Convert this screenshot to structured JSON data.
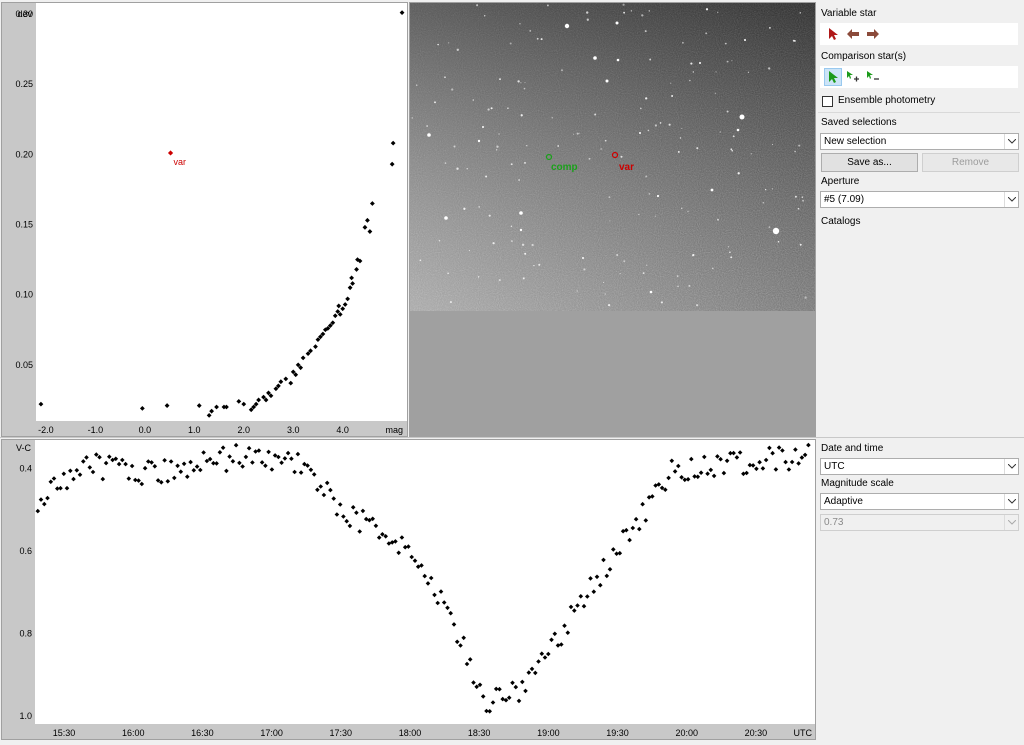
{
  "sidebar": {
    "variable_star_label": "Variable star",
    "comparison_label": "Comparison star(s)",
    "ensemble_label": "Ensemble photometry",
    "ensemble_checked": false,
    "saved_selections_label": "Saved selections",
    "saved_selection_value": "New selection",
    "save_as_label": "Save as...",
    "remove_label": "Remove",
    "aperture_label": "Aperture",
    "aperture_value": "#5 (7.09)",
    "catalogs_label": "Catalogs"
  },
  "lower_sidebar": {
    "date_time_label": "Date and time",
    "date_time_value": "UTC",
    "mag_scale_label": "Magnitude scale",
    "mag_scale_value": "Adaptive",
    "mag_scale_number": "0.73"
  },
  "image_view": {
    "comp_label": "comp",
    "var_label": "var"
  },
  "colors": {
    "var_marker": "#cc0000",
    "comp_marker": "#1aa01a",
    "axis_band": "#c8c8c8",
    "points": "#000000"
  },
  "chart_data": [
    {
      "type": "scatter",
      "xlabel": "mag",
      "ylabel": "dev",
      "xlim": [
        -2.2,
        5.3
      ],
      "ylim": [
        0.01,
        0.305
      ],
      "x_ticks": [
        -2.0,
        -1.0,
        0.0,
        1.0,
        2.0,
        3.0,
        4.0
      ],
      "x_tick_labels": [
        "-2.0",
        "-1.0",
        "0.0",
        "1.0",
        "2.0",
        "3.0",
        "4.0"
      ],
      "y_ticks": [
        0.05,
        0.1,
        0.15,
        0.2,
        0.25,
        0.3
      ],
      "y_tick_labels": [
        "0.05",
        "0.10",
        "0.15",
        "0.20",
        "0.25",
        "0.30"
      ],
      "highlight": {
        "name": "var",
        "x": 0.52,
        "y": 0.201
      },
      "points": [
        [
          -2.1,
          0.022
        ],
        [
          -0.05,
          0.019
        ],
        [
          0.45,
          0.021
        ],
        [
          1.1,
          0.021
        ],
        [
          1.3,
          0.014
        ],
        [
          1.35,
          0.017
        ],
        [
          1.45,
          0.02
        ],
        [
          1.6,
          0.02
        ],
        [
          1.65,
          0.02
        ],
        [
          1.9,
          0.024
        ],
        [
          2.0,
          0.022
        ],
        [
          2.15,
          0.018
        ],
        [
          2.2,
          0.02
        ],
        [
          2.25,
          0.022
        ],
        [
          2.3,
          0.025
        ],
        [
          2.4,
          0.027
        ],
        [
          2.45,
          0.025
        ],
        [
          2.5,
          0.03
        ],
        [
          2.55,
          0.028
        ],
        [
          2.65,
          0.033
        ],
        [
          2.7,
          0.035
        ],
        [
          2.75,
          0.038
        ],
        [
          2.85,
          0.04
        ],
        [
          2.95,
          0.037
        ],
        [
          3.0,
          0.045
        ],
        [
          3.05,
          0.043
        ],
        [
          3.1,
          0.05
        ],
        [
          3.15,
          0.048
        ],
        [
          3.2,
          0.055
        ],
        [
          3.3,
          0.058
        ],
        [
          3.35,
          0.06
        ],
        [
          3.45,
          0.063
        ],
        [
          3.5,
          0.068
        ],
        [
          3.55,
          0.07
        ],
        [
          3.6,
          0.072
        ],
        [
          3.65,
          0.075
        ],
        [
          3.7,
          0.076
        ],
        [
          3.75,
          0.078
        ],
        [
          3.8,
          0.08
        ],
        [
          3.85,
          0.085
        ],
        [
          3.9,
          0.088
        ],
        [
          3.92,
          0.092
        ],
        [
          3.95,
          0.086
        ],
        [
          4.0,
          0.09
        ],
        [
          4.05,
          0.093
        ],
        [
          4.1,
          0.097
        ],
        [
          4.15,
          0.105
        ],
        [
          4.18,
          0.112
        ],
        [
          4.2,
          0.108
        ],
        [
          4.28,
          0.118
        ],
        [
          4.3,
          0.125
        ],
        [
          4.35,
          0.124
        ],
        [
          4.45,
          0.148
        ],
        [
          4.5,
          0.153
        ],
        [
          4.55,
          0.145
        ],
        [
          4.6,
          0.165
        ],
        [
          5.0,
          0.193
        ],
        [
          5.02,
          0.208
        ],
        [
          5.2,
          0.301
        ]
      ]
    },
    {
      "type": "scatter",
      "xlabel": "UTC",
      "ylabel": "V-C",
      "xlim": [
        15.29,
        20.92
      ],
      "ylim": [
        1.02,
        0.34
      ],
      "x_ticks": [
        15.5,
        16.0,
        16.5,
        17.0,
        17.5,
        18.0,
        18.5,
        19.0,
        19.5,
        20.0,
        20.5
      ],
      "x_tick_labels": [
        "15:30",
        "16:00",
        "16:30",
        "17:00",
        "17:30",
        "18:00",
        "18:30",
        "19:00",
        "19:30",
        "20:00",
        "20:30"
      ],
      "y_ticks": [
        0.4,
        0.6,
        0.8,
        1.0
      ],
      "y_tick_labels": [
        "0.4",
        "0.6",
        "0.8",
        "1.0"
      ]
    }
  ]
}
